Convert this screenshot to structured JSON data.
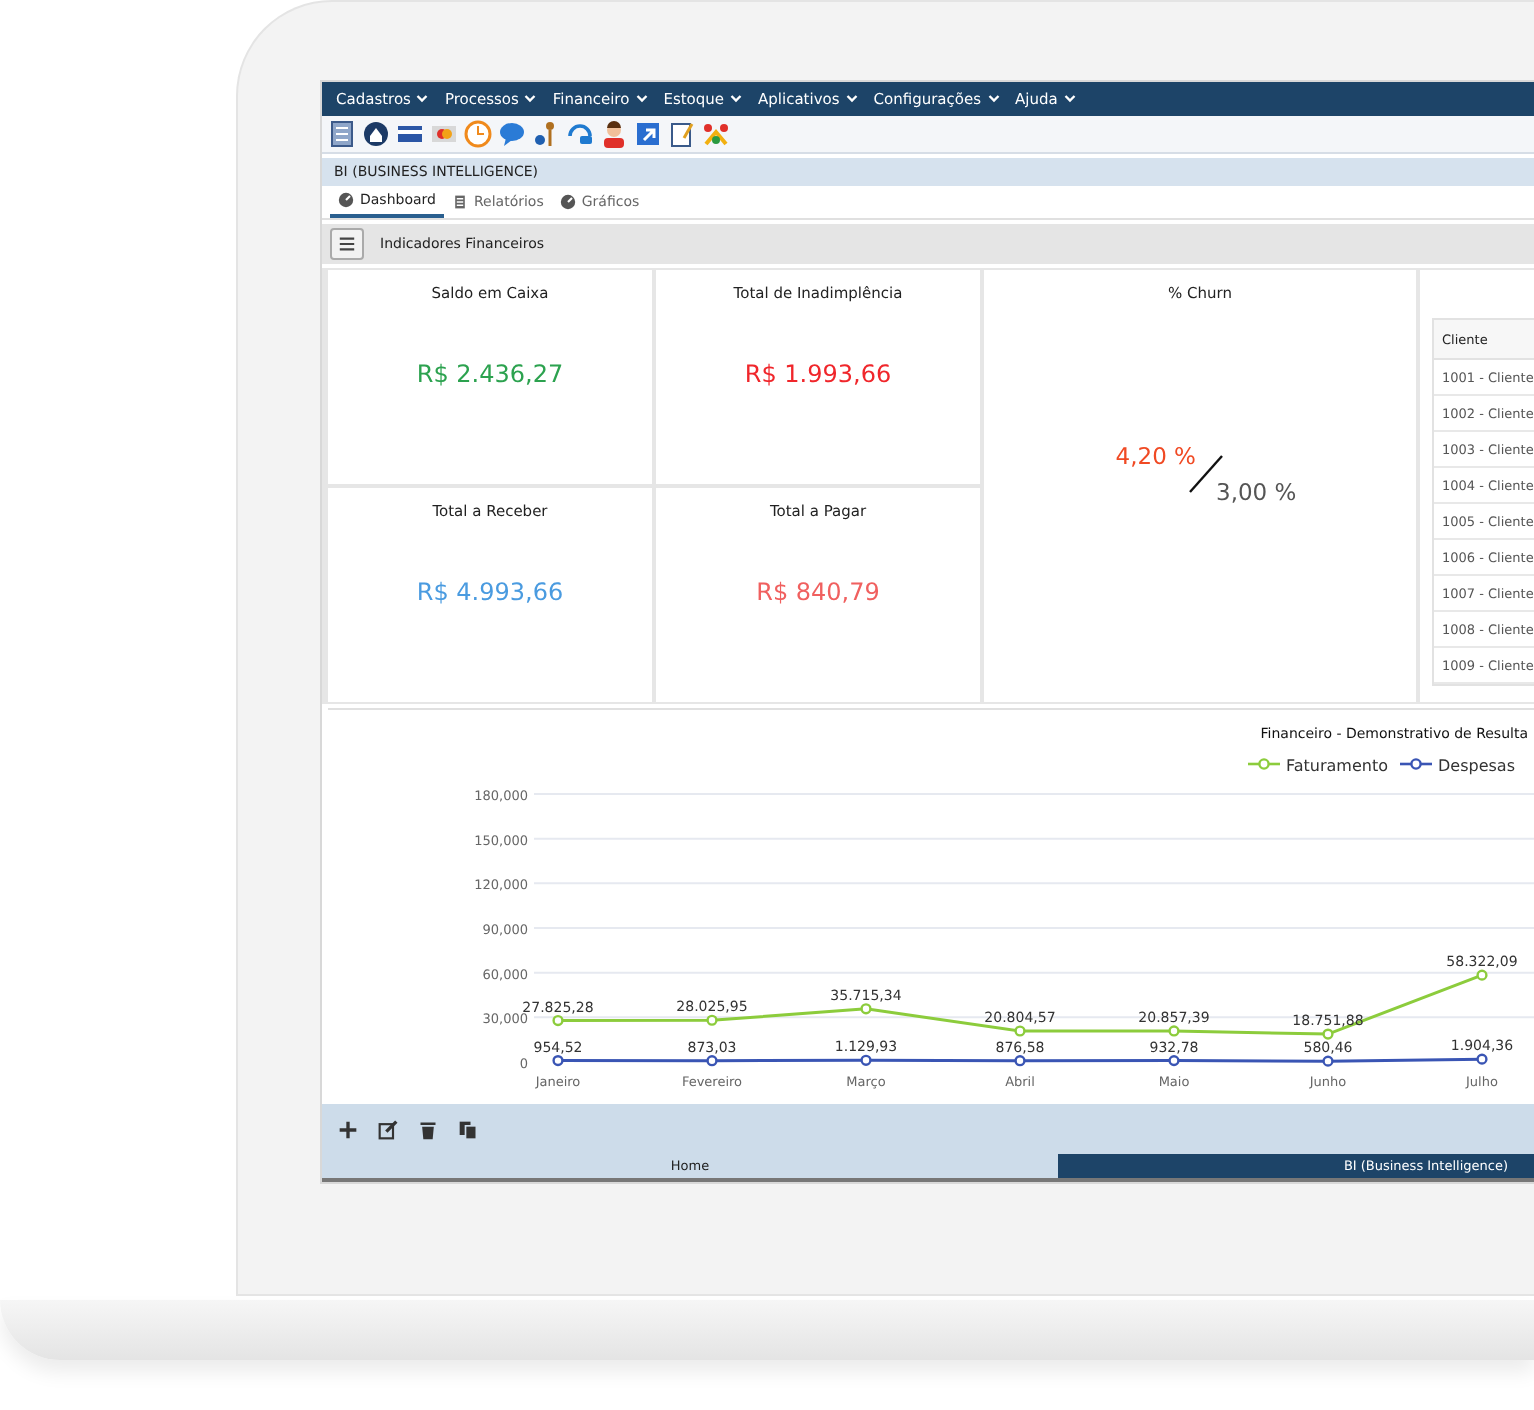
{
  "menu_bar": {
    "items": [
      "Cadastros",
      "Processos",
      "Financeiro",
      "Estoque",
      "Aplicativos",
      "Configurações",
      "Ajuda"
    ]
  },
  "window": {
    "title": "BI (BUSINESS INTELLIGENCE)"
  },
  "tabs": [
    {
      "label": "Dashboard",
      "selected": true
    },
    {
      "label": "Relatórios",
      "selected": false
    },
    {
      "label": "Gráficos",
      "selected": false
    }
  ],
  "section": {
    "title": "Indicadores Financeiros"
  },
  "cards": [
    {
      "title": "Saldo em Caixa",
      "value": "R$ 2.436,27",
      "color": "#2ca24f"
    },
    {
      "title": "Total de Inadimplência",
      "value": "R$ 1.993,66",
      "color": "#f0262b"
    },
    {
      "title": "Total a Receber",
      "value": "R$ 4.993,66",
      "color": "#4a9be0"
    },
    {
      "title": "Total a Pagar",
      "value": "R$ 840,79",
      "color": "#f0605f"
    }
  ],
  "churn": {
    "title": "% Churn",
    "current": "4,20 %",
    "target": "3,00 %"
  },
  "client_table": {
    "columns": [
      "Cliente"
    ],
    "rows": [
      "1001 - Cliente",
      "1002 - Cliente",
      "1003 - Cliente",
      "1004 - Cliente",
      "1005 - Cliente",
      "1006 - Cliente",
      "1007 - Cliente",
      "1008 - Cliente",
      "1009 - Cliente"
    ]
  },
  "chart": {
    "chart_data": {
      "type": "line",
      "title": "Financeiro - Demonstrativo de Resulta",
      "categories": [
        "Janeiro",
        "Fevereiro",
        "Março",
        "Abril",
        "Maio",
        "Junho",
        "Julho"
      ],
      "ylim": [
        0,
        180000
      ],
      "yticks": [
        {
          "value": 0,
          "label": "0"
        },
        {
          "value": 30000,
          "label": "30,000"
        },
        {
          "value": 60000,
          "label": "60,000"
        },
        {
          "value": 90000,
          "label": "90,000"
        },
        {
          "value": 120000,
          "label": "120,000"
        },
        {
          "value": 150000,
          "label": "150,000"
        },
        {
          "value": 180000,
          "label": "180,000"
        }
      ],
      "data_labels": true,
      "grid": true,
      "legend": true,
      "series": [
        {
          "name": "Faturamento",
          "color": "#8ccc3c",
          "marker": "circle",
          "values": [
            27825.28,
            28025.95,
            35715.34,
            20804.57,
            20857.39,
            18751.88,
            58322.09
          ],
          "value_labels": [
            "27.825,28",
            "28.025,95",
            "35.715,34",
            "20.804,57",
            "20.857,39",
            "18.751,88",
            "58.322,09"
          ]
        },
        {
          "name": "Despesas",
          "color": "#3a55b4",
          "marker": "circle",
          "values": [
            954.52,
            873.03,
            1129.93,
            876.58,
            932.78,
            580.46,
            1904.36
          ],
          "value_labels": [
            "954,52",
            "873,03",
            "1.129,93",
            "876,58",
            "932,78",
            "580,46",
            "1.904,36"
          ]
        }
      ]
    }
  },
  "bottom_tabs": [
    {
      "label": "Home",
      "selected": false
    },
    {
      "label": "BI (Business Intelligence)",
      "selected": true
    }
  ]
}
